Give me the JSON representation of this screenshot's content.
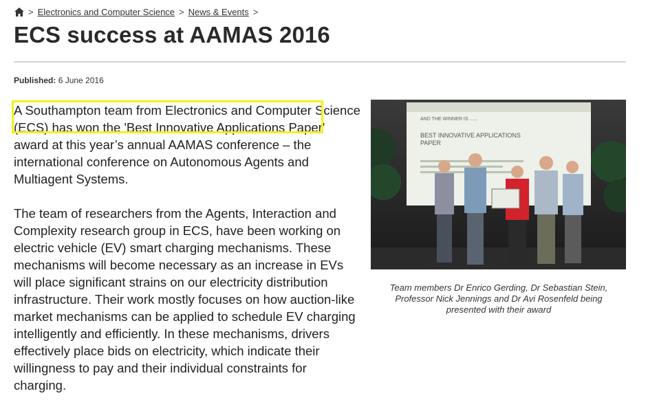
{
  "breadcrumb": {
    "separator": ">",
    "items": [
      "Electronics and Computer Science",
      "News & Events"
    ]
  },
  "page_title": "ECS success at AAMAS 2016",
  "published": {
    "label": "Published:",
    "date": "6 June 2016"
  },
  "body": {
    "paragraphs": [
      "A Southampton team from Electronics and Computer Science (ECS) has won the 'Best Innovative Applications Paper' award at this year’s annual AAMAS conference – the international conference on Autonomous Agents and Multiagent Systems.",
      "The team of researchers from the Agents, Interaction and Complexity research group in ECS, have been working on electric vehicle (EV) smart charging mechanisms. These mechanisms will become necessary as an increase in EVs will place significant strains on our electricity distribution infrastructure. Their work mostly focuses on how auction-like market mechanisms can be applied to schedule EV charging intelligently and efficiently. In these mechanisms, drivers effectively place bids on electricity, which indicate their willingness to pay and their individual constraints for charging."
    ]
  },
  "photo": {
    "screen_text": [
      "AND THE WINNER IS ......",
      "BEST INNOVATIVE APPLICATIONS",
      "PAPER"
    ],
    "caption": "Team members Dr Enrico Gerding, Dr Sebastian Stein, Professor Nick Jennings and Dr Avi Rosenfeld being presented with their award"
  },
  "colors": {
    "highlight": "#f5f01a",
    "title": "#2a2a2a"
  },
  "icons": {
    "home": "home-icon"
  }
}
